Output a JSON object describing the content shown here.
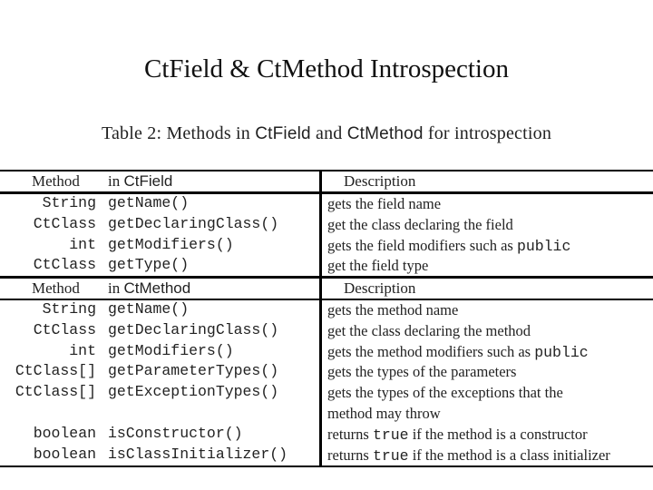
{
  "slide_title": "CtField & CtMethod  Introspection",
  "caption": {
    "prefix": "Table 2:  Methods in ",
    "class1": "CtField",
    "middle": " and ",
    "class2": "CtMethod",
    "suffix": " for introspection"
  },
  "field_section": {
    "header": {
      "method": "Method",
      "in_label": "in ",
      "class_name": "CtField",
      "description": "Description"
    },
    "rows": [
      {
        "return_type": "String",
        "method": "getName()",
        "description": "gets the field name",
        "code": "",
        "description_after": ""
      },
      {
        "return_type": "CtClass",
        "method": "getDeclaringClass()",
        "description": "get the class declaring the field",
        "code": "",
        "description_after": ""
      },
      {
        "return_type": "int",
        "method": "getModifiers()",
        "description": "gets the field modifiers such as ",
        "code": "public",
        "description_after": ""
      },
      {
        "return_type": "CtClass",
        "method": "getType()",
        "description": "get the field type",
        "code": "",
        "description_after": ""
      }
    ]
  },
  "method_section": {
    "header": {
      "method": "Method",
      "in_label": "in ",
      "class_name": "CtMethod",
      "description": "Description"
    },
    "rows": [
      {
        "return_type": "String",
        "method": "getName()",
        "description": "gets the method name",
        "code": "",
        "description_after": ""
      },
      {
        "return_type": "CtClass",
        "method": "getDeclaringClass()",
        "description": "get the class declaring the method",
        "code": "",
        "description_after": ""
      },
      {
        "return_type": "int",
        "method": "getModifiers()",
        "description": "gets the method modifiers such as ",
        "code": "public",
        "description_after": ""
      },
      {
        "return_type": "CtClass[]",
        "method": "getParameterTypes()",
        "description": "gets the types of the parameters",
        "code": "",
        "description_after": ""
      },
      {
        "return_type": "CtClass[]",
        "method": "getExceptionTypes()",
        "description": "gets the types of the exceptions that the",
        "code": "",
        "description_after": ""
      },
      {
        "return_type": "",
        "method": "",
        "description": "method may throw",
        "code": "",
        "description_after": ""
      },
      {
        "return_type": "boolean",
        "method": "isConstructor()",
        "description": "returns ",
        "code": "true",
        "description_after": " if the method is a constructor"
      },
      {
        "return_type": "boolean",
        "method": "isClassInitializer()",
        "description": "returns ",
        "code": "true",
        "description_after": " if the method is a class initializer"
      }
    ]
  }
}
